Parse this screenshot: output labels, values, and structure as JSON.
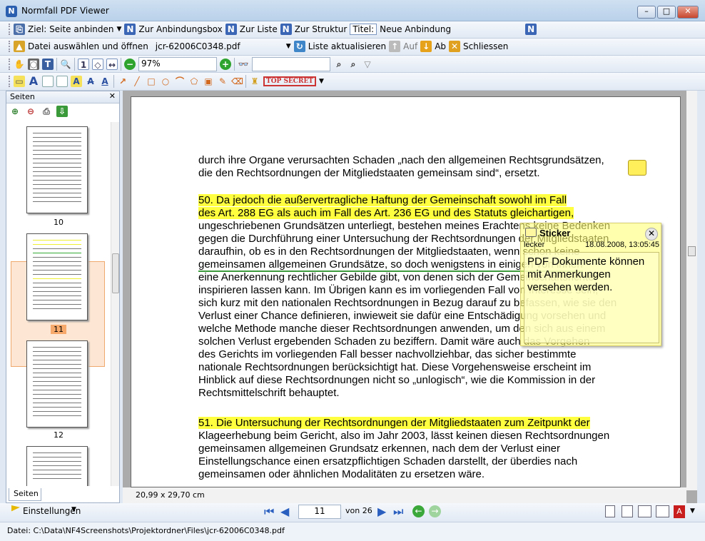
{
  "window": {
    "title": "Normfall PDF Viewer",
    "icon_letter": "N"
  },
  "toolbar1": {
    "target_label": "Ziel: Seite anbinden",
    "to_box": "Zur Anbindungsbox",
    "to_list": "Zur Liste",
    "to_structure": "Zur Struktur",
    "title_label": "Titel:",
    "title_value": "Neue Anbindung"
  },
  "toolbar2": {
    "open_label": "Datei auswählen und öffnen",
    "file_name": "jcr-62006C0348.pdf",
    "refresh": "Liste aktualisieren",
    "up": "Auf",
    "down": "Ab",
    "close": "Schliessen"
  },
  "toolbar3": {
    "zoom": "97%"
  },
  "toolbar4": {
    "stamp": "TOP SECRET"
  },
  "left_panel": {
    "title": "Seiten",
    "tab": "Seiten",
    "thumb_numbers": [
      "10",
      "11",
      "12"
    ]
  },
  "document": {
    "lines": [
      "durch ihre Organe verursachten Schaden „nach den allgemeinen Rechtsgrundsätzen,",
      "die den Rechtsordnungen der Mitgliedstaaten gemeinsam sind“, ersetzt.",
      "50. Da jedoch die außervertragliche Haftung der Gemeinschaft sowohl im Fall",
      "des Art. 288 EG als auch im Fall des Art. 236 EG und des Statuts gleichartigen,",
      "ungeschriebenen Grundsätzen unterliegt, bestehen meines Erachtens keine Bedenken",
      "gegen die Durchführung einer Untersuchung der Rechtsordnungen der Mitgliedstaaten",
      "daraufhin, ob es in den Rechtsordnungen der Mitgliedstaaten, wenn schon keine",
      "gemeinsamen allgemeinen Grundsätze, so doch wenigstens in einigen von ihnen",
      "eine Anerkennung rechtlicher Gebilde gibt, von denen sich der Gemeinschaftsrichter",
      "inspirieren lassen kann. Im Übrigen kann es im vorliegenden Fall von Interesse sein,",
      "sich kurz mit den nationalen Rechtsordnungen in Bezug darauf zu befassen, wie sie den",
      "Verlust einer Chance definieren, inwieweit sie dafür eine Entschädigung vorsehen und",
      "welche Methode manche dieser Rechtsordnungen anwenden, um den sich aus einem",
      "solchen Verlust ergebenden Schaden zu beziffern. Damit wäre auch das Vorgehen",
      "des Gerichts im vorliegenden Fall besser nachvollziehbar, das sicher bestimmte",
      "nationale Rechtsordnungen berücksichtigt hat. Diese Vorgehensweise erscheint im",
      "Hinblick auf diese Rechtsordnungen nicht so „unlogisch“, wie die Kommission in der",
      "Rechtsmittelschrift behauptet.",
      "51. Die Untersuchung der Rechtsordnungen der Mitgliedstaaten zum Zeitpunkt der",
      "Klageerhebung beim Gericht, also im Jahr 2003, lässt keinen diesen Rechtsordnungen",
      "gemeinsamen allgemeinen Grundsatz erkennen, nach dem der Verlust einer",
      "Einstellungschance einen ersatzpflichtigen Schaden darstellt, der überdies nach",
      "gemeinsamen oder ähnlichen Modalitäten zu ersetzen wäre."
    ],
    "page_size": "20,99 x 29,70 cm"
  },
  "sticker": {
    "title": "Sticker",
    "author": "lecker",
    "date": "18.08.2008, 13:05:45",
    "body": "PDF Dokumente können mit Anmerkungen versehen werden."
  },
  "bottom": {
    "settings": "Einstellungen",
    "page_current": "11",
    "page_of": "von 26"
  },
  "status": {
    "path": "Datei: C:\\Data\\NF4Screenshots\\Projektordner\\Files\\jcr-62006C0348.pdf"
  }
}
